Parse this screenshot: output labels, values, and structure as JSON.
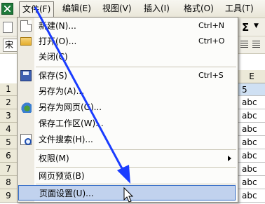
{
  "menubar": {
    "items": [
      {
        "label": "文件(F)"
      },
      {
        "label": "编辑(E)"
      },
      {
        "label": "视图(V)"
      },
      {
        "label": "插入(I)"
      },
      {
        "label": "格式(O)"
      },
      {
        "label": "工具(T)"
      }
    ]
  },
  "toolbar": {
    "sigma": "Σ",
    "font_prefix": "宋"
  },
  "grid": {
    "column_header": "E",
    "rows": [
      {
        "num": "1",
        "value": "5"
      },
      {
        "num": "2",
        "value": "abc"
      },
      {
        "num": "3",
        "value": "abc"
      },
      {
        "num": "4",
        "value": "abc"
      },
      {
        "num": "5",
        "value": "abc"
      },
      {
        "num": "6",
        "value": "abc"
      },
      {
        "num": "7",
        "value": "abc"
      },
      {
        "num": "8",
        "value": "abc"
      },
      {
        "num": "9",
        "value": "abc"
      }
    ]
  },
  "file_menu": {
    "new": {
      "label": "新建(N)...",
      "shortcut": "Ctrl+N"
    },
    "open": {
      "label": "打开(O)...",
      "shortcut": "Ctrl+O"
    },
    "close": {
      "label": "关闭(C)"
    },
    "save": {
      "label": "保存(S)",
      "shortcut": "Ctrl+S"
    },
    "save_as": {
      "label": "另存为(A)..."
    },
    "save_as_web": {
      "label": "另存为网页(G)..."
    },
    "save_workspace": {
      "label": "保存工作区(W)..."
    },
    "file_search": {
      "label": "文件搜索(H)..."
    },
    "permission": {
      "label": "权限(M)"
    },
    "web_preview": {
      "label": "网页预览(B)"
    },
    "page_setup": {
      "label": "页面设置(U)..."
    }
  }
}
